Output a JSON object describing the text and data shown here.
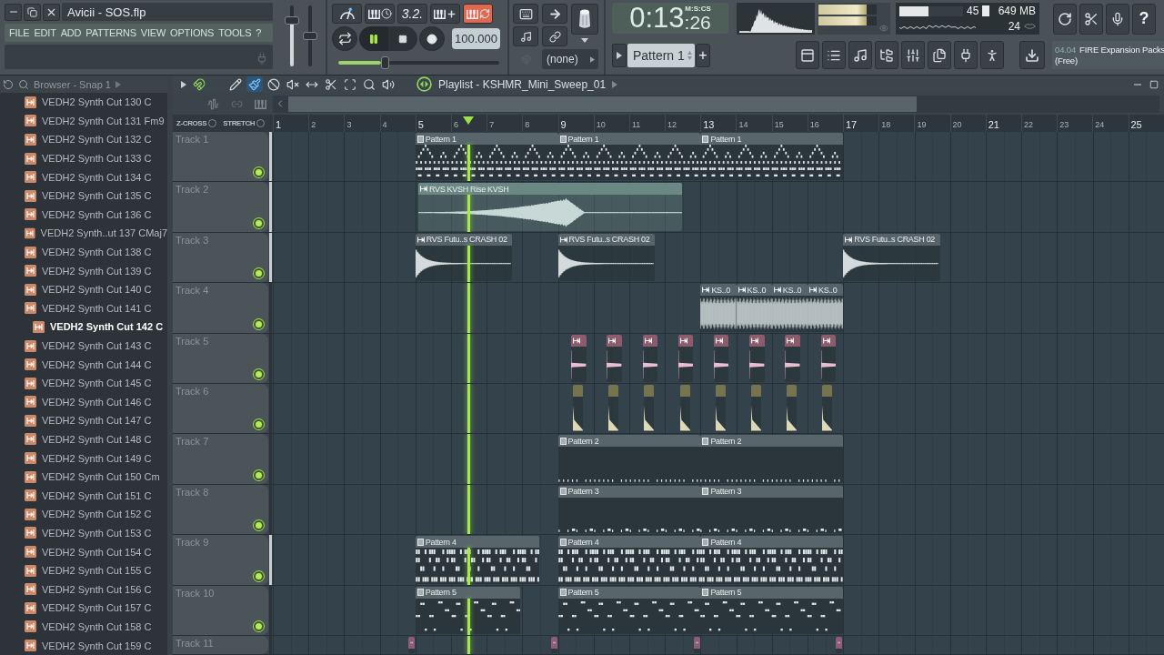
{
  "window": {
    "title": "Avicii - SOS.flp"
  },
  "menu": [
    "FILE",
    "EDIT",
    "ADD",
    "PATTERNS",
    "VIEW",
    "OPTIONS",
    "TOOLS",
    "?"
  ],
  "master": {
    "volume": {
      "level": 0.79
    },
    "pitch": {
      "level": 0.5
    }
  },
  "transport": {
    "countdown": "3.2.",
    "loop_record": true,
    "playing": true,
    "tempo": "100.000",
    "song_position": {
      "level": 0.29
    }
  },
  "snap": {
    "value": "(none)"
  },
  "time": {
    "value": "0:13",
    "fraction": ":26",
    "format": "M:S:CS"
  },
  "pattern": {
    "name": "Pattern 1",
    "add": "+"
  },
  "output_meters": [
    {
      "level": 0.82
    },
    {
      "level": 0.82
    }
  ],
  "performance": {
    "cpu": {
      "reading": "45",
      "level": 0.45
    },
    "memory": "649 MB",
    "polyphony": "24"
  },
  "help": "?",
  "news": {
    "date": "04.04",
    "lines": [
      "FIRE Expansion Packs",
      "(Free)"
    ]
  },
  "browser": {
    "title": "Browser - Snap 1",
    "items": [
      {
        "label": "VEDH2 Synth Cut 130 C",
        "selected": false
      },
      {
        "label": "VEDH2 Synth Cut 131 Fm9",
        "selected": false
      },
      {
        "label": "VEDH2 Synth Cut 132 C",
        "selected": false
      },
      {
        "label": "VEDH2 Synth Cut 133 C",
        "selected": false
      },
      {
        "label": "VEDH2 Synth Cut 134 C",
        "selected": false
      },
      {
        "label": "VEDH2 Synth Cut 135 C",
        "selected": false
      },
      {
        "label": "VEDH2 Synth Cut 136 C",
        "selected": false
      },
      {
        "label": "VEDH2 Synth..ut 137 CMaj7",
        "selected": false
      },
      {
        "label": "VEDH2 Synth Cut 138 C",
        "selected": false
      },
      {
        "label": "VEDH2 Synth Cut 139 C",
        "selected": false
      },
      {
        "label": "VEDH2 Synth Cut 140 C",
        "selected": false
      },
      {
        "label": "VEDH2 Synth Cut 141 C",
        "selected": false
      },
      {
        "label": "VEDH2 Synth Cut 142 C",
        "selected": true
      },
      {
        "label": "VEDH2 Synth Cut 143 C",
        "selected": false
      },
      {
        "label": "VEDH2 Synth Cut 144 C",
        "selected": false
      },
      {
        "label": "VEDH2 Synth Cut 145 C",
        "selected": false
      },
      {
        "label": "VEDH2 Synth Cut 146 C",
        "selected": false
      },
      {
        "label": "VEDH2 Synth Cut 147 C",
        "selected": false
      },
      {
        "label": "VEDH2 Synth Cut 148 C",
        "selected": false
      },
      {
        "label": "VEDH2 Synth Cut 149 C",
        "selected": false
      },
      {
        "label": "VEDH2 Synth Cut 150 Cm",
        "selected": false
      },
      {
        "label": "VEDH2 Synth Cut 151 C",
        "selected": false
      },
      {
        "label": "VEDH2 Synth Cut 152 C",
        "selected": false
      },
      {
        "label": "VEDH2 Synth Cut 153 C",
        "selected": false
      },
      {
        "label": "VEDH2 Synth Cut 154 C",
        "selected": false
      },
      {
        "label": "VEDH2 Synth Cut 155 C",
        "selected": false
      },
      {
        "label": "VEDH2 Synth Cut 156 C",
        "selected": false
      },
      {
        "label": "VEDH2 Synth Cut 157 C",
        "selected": false
      },
      {
        "label": "VEDH2 Synth Cut 158 C",
        "selected": false
      },
      {
        "label": "VEDH2 Synth Cut 159 C",
        "selected": false
      }
    ]
  },
  "playlist": {
    "title": "Playlist - KSHMR_Mini_Sweep_01",
    "snap_on": true,
    "tools": [
      {
        "kind": "draw",
        "selected": false
      },
      {
        "kind": "paint",
        "selected": true
      },
      {
        "kind": "delete",
        "selected": false
      },
      {
        "kind": "mute",
        "selected": false
      },
      {
        "kind": "slip",
        "selected": false
      },
      {
        "kind": "slice",
        "selected": false
      },
      {
        "kind": "select",
        "selected": false
      },
      {
        "kind": "zoom",
        "selected": false
      },
      {
        "kind": "playback",
        "selected": false
      }
    ],
    "z_cross": {
      "label": "Z-CROSS",
      "checked": false
    },
    "stretch": {
      "label": "STRETCH",
      "checked": false
    },
    "bars": [
      "1",
      "2",
      "3",
      "4",
      "5",
      "6",
      "7",
      "8",
      "9",
      "10",
      "11",
      "12",
      "13",
      "14",
      "15",
      "16",
      "17",
      "18",
      "19",
      "20",
      "21",
      "22",
      "23",
      "24",
      "25"
    ],
    "tracks": [
      {
        "name": "Track 1",
        "on": true,
        "selected": true,
        "clips": [
          {
            "kind": "pattern",
            "label": "Pattern 1"
          },
          {
            "kind": "pattern",
            "label": "Pattern 1"
          },
          {
            "kind": "pattern",
            "label": "Pattern 1"
          }
        ]
      },
      {
        "name": "Track 2",
        "on": true,
        "selected": true,
        "clips": [
          {
            "kind": "audio",
            "label": "RVS KVSH Rise KVSH",
            "color": "#6c8884"
          }
        ]
      },
      {
        "name": "Track 3",
        "on": true,
        "selected": true,
        "clips": [
          {
            "kind": "audio",
            "label": "RVS Futu..s CRASH 02"
          },
          {
            "kind": "audio",
            "label": "RVS Futu..s CRASH 02"
          },
          {
            "kind": "audio",
            "label": "RVS Futu..s CRASH 02"
          }
        ]
      },
      {
        "name": "Track 4",
        "on": true,
        "selected": false,
        "clips": [
          {
            "kind": "audio",
            "label": "KS..0"
          },
          {
            "kind": "audio",
            "label": "KS..0"
          },
          {
            "kind": "audio",
            "label": "KS..0"
          },
          {
            "kind": "audio",
            "label": "KS..0"
          }
        ]
      },
      {
        "name": "Track 5",
        "on": true,
        "selected": false,
        "clips": [
          {
            "kind": "audio",
            "color": "#8d5c6c"
          },
          {
            "kind": "audio",
            "color": "#8d5c6c"
          },
          {
            "kind": "audio",
            "color": "#8d5c6c"
          },
          {
            "kind": "audio",
            "color": "#8d5c6c"
          },
          {
            "kind": "audio",
            "color": "#8d5c6c"
          },
          {
            "kind": "audio",
            "color": "#8d5c6c"
          },
          {
            "kind": "audio",
            "color": "#8d5c6c"
          },
          {
            "kind": "audio",
            "color": "#8d5c6c"
          }
        ]
      },
      {
        "name": "Track 6",
        "on": true,
        "selected": false,
        "clips": [
          {
            "kind": "audio",
            "color": "#76744f"
          },
          {
            "kind": "audio",
            "color": "#76744f"
          },
          {
            "kind": "audio",
            "color": "#76744f"
          },
          {
            "kind": "audio",
            "color": "#76744f"
          },
          {
            "kind": "audio",
            "color": "#76744f"
          },
          {
            "kind": "audio",
            "color": "#76744f"
          },
          {
            "kind": "audio",
            "color": "#76744f"
          },
          {
            "kind": "audio",
            "color": "#76744f"
          }
        ]
      },
      {
        "name": "Track 7",
        "on": true,
        "selected": false,
        "clips": [
          {
            "kind": "pattern",
            "label": "Pattern 2"
          },
          {
            "kind": "pattern",
            "label": "Pattern 2"
          }
        ]
      },
      {
        "name": "Track 8",
        "on": true,
        "selected": false,
        "clips": [
          {
            "kind": "pattern",
            "label": "Pattern 3"
          },
          {
            "kind": "pattern",
            "label": "Pattern 3"
          }
        ]
      },
      {
        "name": "Track 9",
        "on": true,
        "selected": true,
        "clips": [
          {
            "kind": "pattern",
            "label": "Pattern 4"
          },
          {
            "kind": "pattern",
            "label": "Pattern 4"
          },
          {
            "kind": "pattern",
            "label": "Pattern 4"
          }
        ]
      },
      {
        "name": "Track 10",
        "on": true,
        "selected": false,
        "clips": [
          {
            "kind": "pattern",
            "label": "Pattern 5"
          },
          {
            "kind": "pattern",
            "label": "Pattern 5"
          },
          {
            "kind": "pattern",
            "label": "Pattern 5"
          }
        ]
      },
      {
        "name": "Track 11",
        "selected": false,
        "clips": [
          {
            "kind": "audio",
            "color": "#8d5c78"
          },
          {
            "kind": "audio",
            "color": "#8d5c78"
          },
          {
            "kind": "audio",
            "color": "#8d5c78"
          },
          {
            "kind": "audio",
            "color": "#8d5c78"
          }
        ]
      }
    ]
  }
}
